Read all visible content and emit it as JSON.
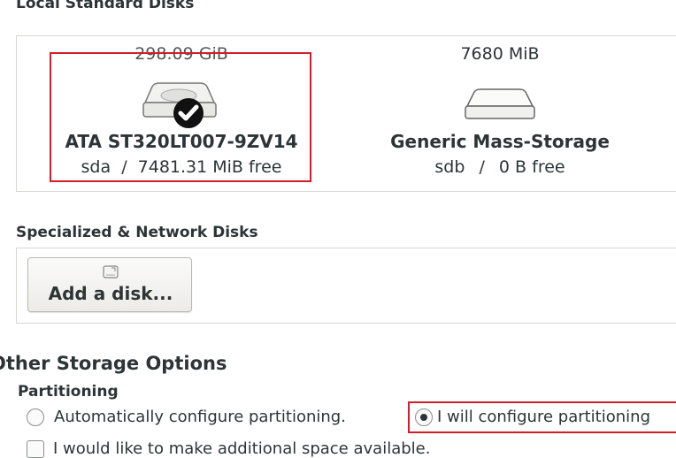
{
  "local_disks": {
    "title": "Local Standard Disks",
    "disks": [
      {
        "size": "298.09 GiB",
        "name": "ATA ST320LT007-9ZV14",
        "device": "sda",
        "separator": "/",
        "free": "7481.31 MiB free",
        "selected": true
      },
      {
        "size": "7680 MiB",
        "name": "Generic Mass-Storage",
        "device": "sdb",
        "separator": "/",
        "free": "0 B free",
        "selected": false
      }
    ]
  },
  "specialized": {
    "title": "Specialized & Network Disks",
    "add_disk_label": "Add a disk..."
  },
  "other_storage": {
    "title": "Other Storage Options",
    "partitioning_label": "Partitioning",
    "options": [
      {
        "label": "Automatically configure partitioning.",
        "selected": false
      },
      {
        "label": "I will configure partitioning",
        "selected": true
      }
    ],
    "hidden_option_partial": "I would like to make additional space available."
  },
  "colors": {
    "highlight": "#d01f2a",
    "text": "#2e3436",
    "border": "#d6d6d3"
  },
  "icons": [
    "hard-disk-icon",
    "checkmark-icon",
    "usb-disk-icon",
    "disk-small-icon"
  ]
}
